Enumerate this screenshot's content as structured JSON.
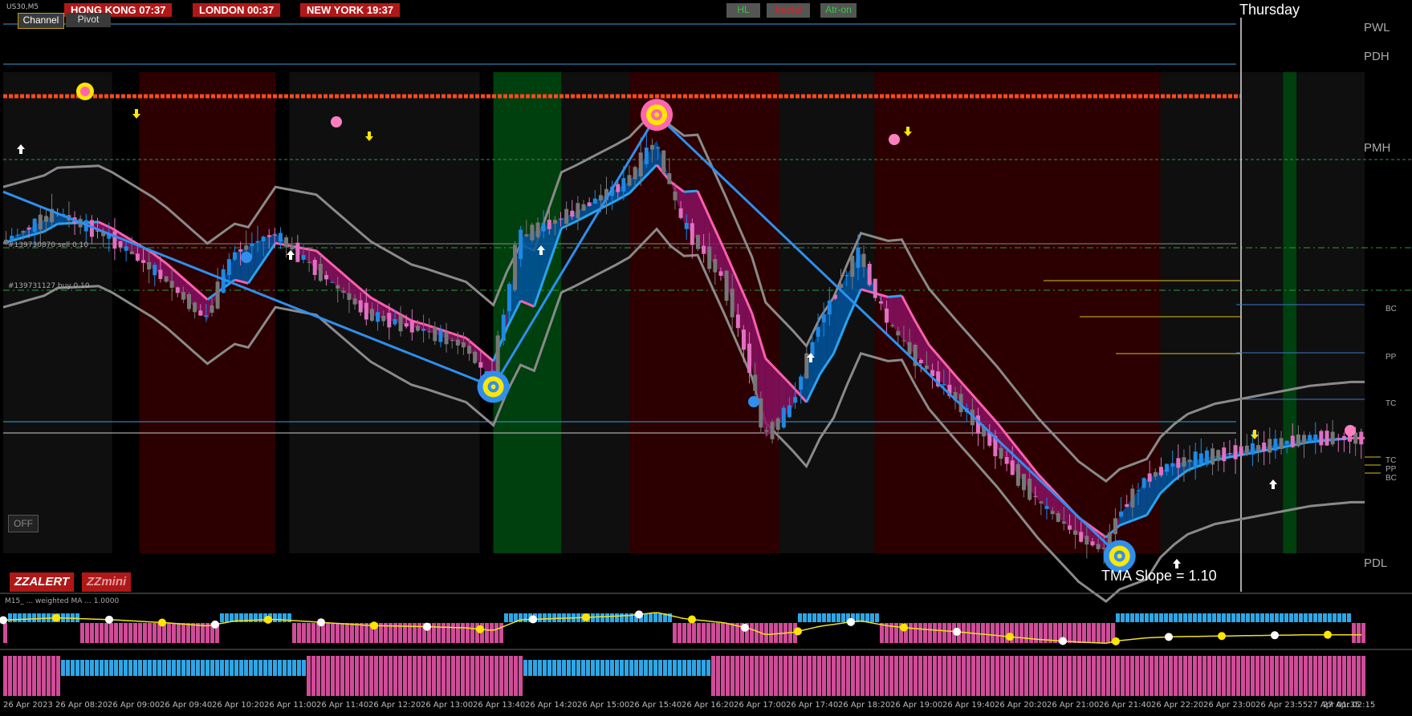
{
  "header": {
    "symbol": "US30,M5",
    "sessions": [
      {
        "label": "HONG KONG 07:37"
      },
      {
        "label": "LONDON  00:37"
      },
      {
        "label": "NEW YORK 19:37"
      }
    ],
    "channel_button": "Channel",
    "pivot_button": "Pivot",
    "hl_button": "HL",
    "fractal_button": "fractal",
    "atr_button": "Atr-on",
    "weekday": "Thursday"
  },
  "levels": {
    "pwl": "PWL",
    "pdh": "PDH",
    "pmh": "PMH",
    "pdl": "PDL",
    "pivot_top": {
      "bc": "BC",
      "pp": "PP",
      "tc": "TC"
    },
    "pivot_small": {
      "tc": "TC",
      "pp": "PP",
      "bc": "BC"
    }
  },
  "orders": {
    "sell": "#139730870 sell 0.10",
    "buy": "#139731127 buy 0.10"
  },
  "tma_slope": "TMA Slope = 1.10",
  "buttons": {
    "off": "OFF",
    "zzalert": "ZZALERT",
    "zzmini": "ZZmini"
  },
  "indicator": {
    "title": "M15_ ... weighted MA ... 1.0000"
  },
  "colors": {
    "bull": "#1e88e5",
    "bear": "#e070c0",
    "tma_bull": "#29a3f0",
    "tma_bear": "#ff5fb0",
    "band": "#8a8a8a",
    "zigzag": "#2f8fee",
    "session_red": "#b01818",
    "fill_bull": "#0055a0",
    "fill_bear": "#8a1060",
    "bg_dark_red": "#3e0000",
    "bg_green": "#005a14",
    "bg_grey": "#151515"
  },
  "chart_data": {
    "type": "candlestick",
    "symbol": "US30",
    "timeframe": "M5",
    "x_tick_labels": [
      "26 Apr 2023",
      "26 Apr 08:20",
      "26 Apr 09:00",
      "26 Apr 09:40",
      "26 Apr 10:20",
      "26 Apr 11:00",
      "26 Apr 11:40",
      "26 Apr 12:20",
      "26 Apr 13:00",
      "26 Apr 13:40",
      "26 Apr 14:20",
      "26 Apr 15:00",
      "26 Apr 15:40",
      "26 Apr 16:20",
      "26 Apr 17:00",
      "26 Apr 17:40",
      "26 Apr 18:20",
      "26 Apr 19:00",
      "26 Apr 19:40",
      "26 Apr 20:20",
      "26 Apr 21:00",
      "26 Apr 21:40",
      "26 Apr 22:20",
      "26 Apr 23:00",
      "26 Apr 23:55",
      "27 Apr 01:35",
      "27 Apr 02:15"
    ],
    "y_axis": "price (scale not printed)",
    "close_profile": [
      [
        0,
        0.62
      ],
      [
        4,
        0.68
      ],
      [
        8,
        0.63
      ],
      [
        12,
        0.55
      ],
      [
        15,
        0.47
      ],
      [
        17,
        0.6
      ],
      [
        20,
        0.64
      ],
      [
        23,
        0.57
      ],
      [
        27,
        0.48
      ],
      [
        31,
        0.45
      ],
      [
        34,
        0.42
      ],
      [
        36,
        0.35
      ],
      [
        38,
        0.63
      ],
      [
        42,
        0.68
      ],
      [
        46,
        0.74
      ],
      [
        48,
        0.82
      ],
      [
        50,
        0.66
      ],
      [
        53,
        0.55
      ],
      [
        55,
        0.38
      ],
      [
        56,
        0.24
      ],
      [
        58,
        0.3
      ],
      [
        60,
        0.46
      ],
      [
        62,
        0.56
      ],
      [
        63,
        0.6
      ],
      [
        65,
        0.47
      ],
      [
        67,
        0.4
      ],
      [
        70,
        0.32
      ],
      [
        73,
        0.22
      ],
      [
        76,
        0.12
      ],
      [
        79,
        0.05
      ],
      [
        81,
        0.02
      ],
      [
        82,
        0.09
      ],
      [
        84,
        0.16
      ],
      [
        86,
        0.19
      ],
      [
        90,
        0.21
      ],
      [
        94,
        0.23
      ],
      [
        96,
        0.24
      ],
      [
        100,
        0.24
      ]
    ],
    "zigzag_points": [
      [
        0,
        0.72
      ],
      [
        36,
        0.34
      ],
      [
        48,
        0.87
      ],
      [
        82,
        0.01
      ]
    ],
    "grid": false
  }
}
